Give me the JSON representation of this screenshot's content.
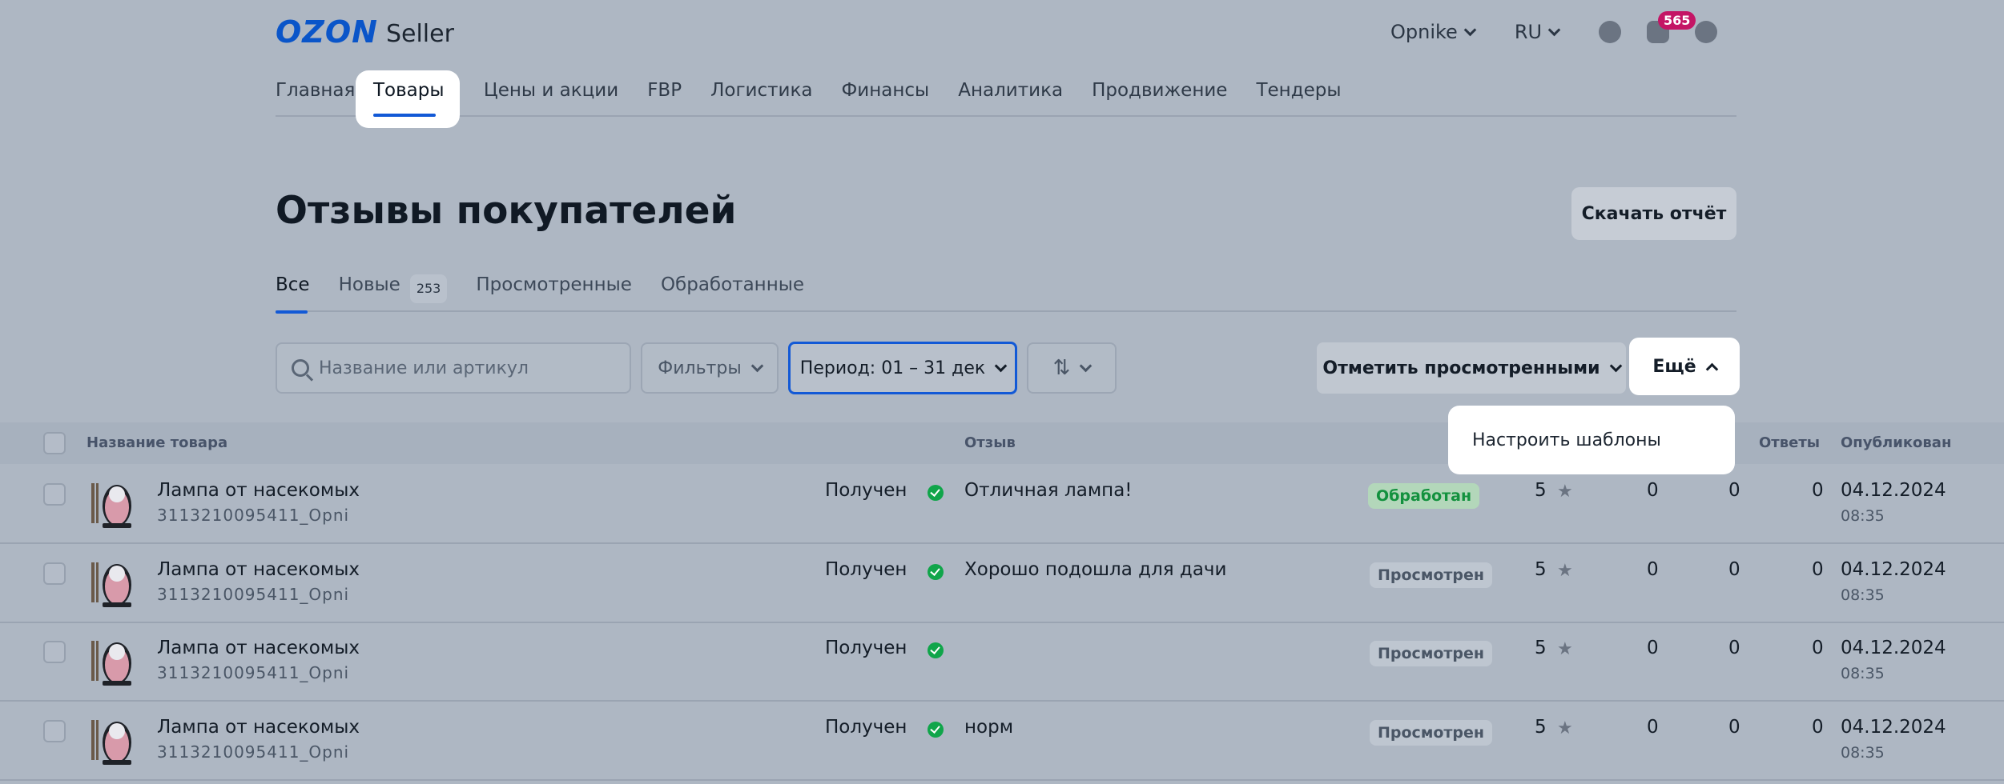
{
  "header": {
    "logo_main": "OZON",
    "logo_sub": "Seller",
    "company": "Opnike",
    "language": "RU",
    "notifications_count": "565"
  },
  "nav": {
    "items": [
      "Главная",
      "Товары",
      "Цены и акции",
      "FBP",
      "Логистика",
      "Финансы",
      "Аналитика",
      "Продвижение",
      "Тендеры"
    ],
    "active": "Товары"
  },
  "page": {
    "title": "Отзывы покупателей",
    "report_button": "Скачать отчёт"
  },
  "tabs": [
    {
      "label": "Все",
      "count": ""
    },
    {
      "label": "Новые",
      "count": "253"
    },
    {
      "label": "Просмотренные",
      "count": ""
    },
    {
      "label": "Обработанные",
      "count": ""
    }
  ],
  "toolbar": {
    "search_placeholder": "Название или артикул",
    "filters_label": "Фильтры",
    "period_label": "Период: 01 – 31 дек",
    "mark_viewed_label": "Отметить просмотренными",
    "more_label": "Ещё",
    "more_menu": [
      "Настроить шаблоны"
    ]
  },
  "table": {
    "columns": {
      "product": "Название товара",
      "review": "Отзыв",
      "answers": "Ответы",
      "published": "Опубликован"
    },
    "rows": [
      {
        "name": "Лампа от насекомых",
        "code": "3113210095411_Opni",
        "received": "Получен",
        "review": "Отличная лампа!",
        "status": "Обработан",
        "status_kind": "done",
        "rating": "5",
        "c1": "0",
        "c2": "0",
        "answers": "0",
        "date": "04.12.2024",
        "time": "08:35"
      },
      {
        "name": "Лампа от насекомых",
        "code": "3113210095411_Opni",
        "received": "Получен",
        "review": "Хорошо подошла для дачи",
        "status": "Просмотрен",
        "status_kind": "seen",
        "rating": "5",
        "c1": "0",
        "c2": "0",
        "answers": "0",
        "date": "04.12.2024",
        "time": "08:35"
      },
      {
        "name": "Лампа от насекомых",
        "code": "3113210095411_Opni",
        "received": "Получен",
        "review": "",
        "status": "Просмотрен",
        "status_kind": "seen",
        "rating": "5",
        "c1": "0",
        "c2": "0",
        "answers": "0",
        "date": "04.12.2024",
        "time": "08:35"
      },
      {
        "name": "Лампа от насекомых",
        "code": "3113210095411_Opni",
        "received": "Получен",
        "review": "норм",
        "status": "Просмотрен",
        "status_kind": "seen",
        "rating": "5",
        "c1": "0",
        "c2": "0",
        "answers": "0",
        "date": "04.12.2024",
        "time": "08:35"
      }
    ]
  },
  "colors": {
    "accent": "#1259d6",
    "brand": "#0a55c9",
    "badge": "#c41565",
    "success": "#10a54a"
  }
}
